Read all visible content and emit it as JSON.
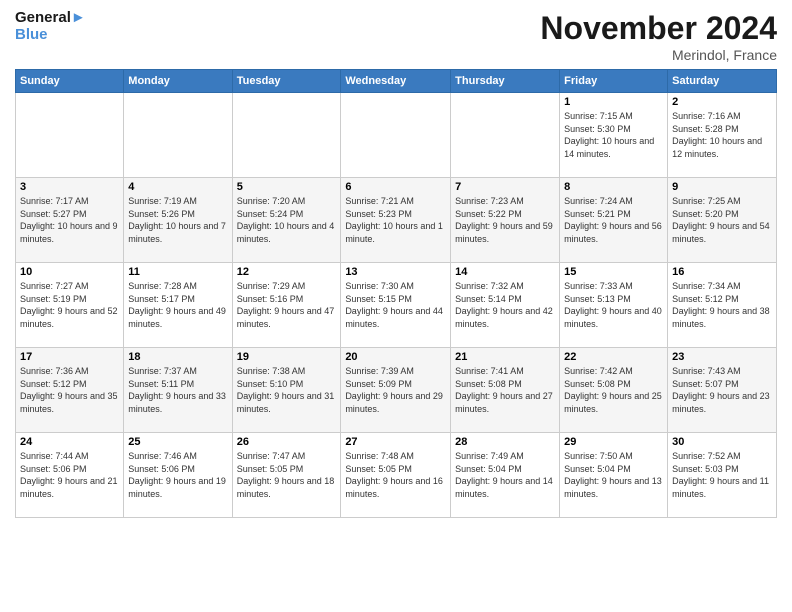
{
  "header": {
    "logo_line1": "General",
    "logo_line2": "Blue",
    "month": "November 2024",
    "location": "Merindol, France"
  },
  "weekdays": [
    "Sunday",
    "Monday",
    "Tuesday",
    "Wednesday",
    "Thursday",
    "Friday",
    "Saturday"
  ],
  "weeks": [
    [
      {
        "day": "",
        "info": ""
      },
      {
        "day": "",
        "info": ""
      },
      {
        "day": "",
        "info": ""
      },
      {
        "day": "",
        "info": ""
      },
      {
        "day": "",
        "info": ""
      },
      {
        "day": "1",
        "info": "Sunrise: 7:15 AM\nSunset: 5:30 PM\nDaylight: 10 hours and 14 minutes."
      },
      {
        "day": "2",
        "info": "Sunrise: 7:16 AM\nSunset: 5:28 PM\nDaylight: 10 hours and 12 minutes."
      }
    ],
    [
      {
        "day": "3",
        "info": "Sunrise: 7:17 AM\nSunset: 5:27 PM\nDaylight: 10 hours and 9 minutes."
      },
      {
        "day": "4",
        "info": "Sunrise: 7:19 AM\nSunset: 5:26 PM\nDaylight: 10 hours and 7 minutes."
      },
      {
        "day": "5",
        "info": "Sunrise: 7:20 AM\nSunset: 5:24 PM\nDaylight: 10 hours and 4 minutes."
      },
      {
        "day": "6",
        "info": "Sunrise: 7:21 AM\nSunset: 5:23 PM\nDaylight: 10 hours and 1 minute."
      },
      {
        "day": "7",
        "info": "Sunrise: 7:23 AM\nSunset: 5:22 PM\nDaylight: 9 hours and 59 minutes."
      },
      {
        "day": "8",
        "info": "Sunrise: 7:24 AM\nSunset: 5:21 PM\nDaylight: 9 hours and 56 minutes."
      },
      {
        "day": "9",
        "info": "Sunrise: 7:25 AM\nSunset: 5:20 PM\nDaylight: 9 hours and 54 minutes."
      }
    ],
    [
      {
        "day": "10",
        "info": "Sunrise: 7:27 AM\nSunset: 5:19 PM\nDaylight: 9 hours and 52 minutes."
      },
      {
        "day": "11",
        "info": "Sunrise: 7:28 AM\nSunset: 5:17 PM\nDaylight: 9 hours and 49 minutes."
      },
      {
        "day": "12",
        "info": "Sunrise: 7:29 AM\nSunset: 5:16 PM\nDaylight: 9 hours and 47 minutes."
      },
      {
        "day": "13",
        "info": "Sunrise: 7:30 AM\nSunset: 5:15 PM\nDaylight: 9 hours and 44 minutes."
      },
      {
        "day": "14",
        "info": "Sunrise: 7:32 AM\nSunset: 5:14 PM\nDaylight: 9 hours and 42 minutes."
      },
      {
        "day": "15",
        "info": "Sunrise: 7:33 AM\nSunset: 5:13 PM\nDaylight: 9 hours and 40 minutes."
      },
      {
        "day": "16",
        "info": "Sunrise: 7:34 AM\nSunset: 5:12 PM\nDaylight: 9 hours and 38 minutes."
      }
    ],
    [
      {
        "day": "17",
        "info": "Sunrise: 7:36 AM\nSunset: 5:12 PM\nDaylight: 9 hours and 35 minutes."
      },
      {
        "day": "18",
        "info": "Sunrise: 7:37 AM\nSunset: 5:11 PM\nDaylight: 9 hours and 33 minutes."
      },
      {
        "day": "19",
        "info": "Sunrise: 7:38 AM\nSunset: 5:10 PM\nDaylight: 9 hours and 31 minutes."
      },
      {
        "day": "20",
        "info": "Sunrise: 7:39 AM\nSunset: 5:09 PM\nDaylight: 9 hours and 29 minutes."
      },
      {
        "day": "21",
        "info": "Sunrise: 7:41 AM\nSunset: 5:08 PM\nDaylight: 9 hours and 27 minutes."
      },
      {
        "day": "22",
        "info": "Sunrise: 7:42 AM\nSunset: 5:08 PM\nDaylight: 9 hours and 25 minutes."
      },
      {
        "day": "23",
        "info": "Sunrise: 7:43 AM\nSunset: 5:07 PM\nDaylight: 9 hours and 23 minutes."
      }
    ],
    [
      {
        "day": "24",
        "info": "Sunrise: 7:44 AM\nSunset: 5:06 PM\nDaylight: 9 hours and 21 minutes."
      },
      {
        "day": "25",
        "info": "Sunrise: 7:46 AM\nSunset: 5:06 PM\nDaylight: 9 hours and 19 minutes."
      },
      {
        "day": "26",
        "info": "Sunrise: 7:47 AM\nSunset: 5:05 PM\nDaylight: 9 hours and 18 minutes."
      },
      {
        "day": "27",
        "info": "Sunrise: 7:48 AM\nSunset: 5:05 PM\nDaylight: 9 hours and 16 minutes."
      },
      {
        "day": "28",
        "info": "Sunrise: 7:49 AM\nSunset: 5:04 PM\nDaylight: 9 hours and 14 minutes."
      },
      {
        "day": "29",
        "info": "Sunrise: 7:50 AM\nSunset: 5:04 PM\nDaylight: 9 hours and 13 minutes."
      },
      {
        "day": "30",
        "info": "Sunrise: 7:52 AM\nSunset: 5:03 PM\nDaylight: 9 hours and 11 minutes."
      }
    ]
  ]
}
